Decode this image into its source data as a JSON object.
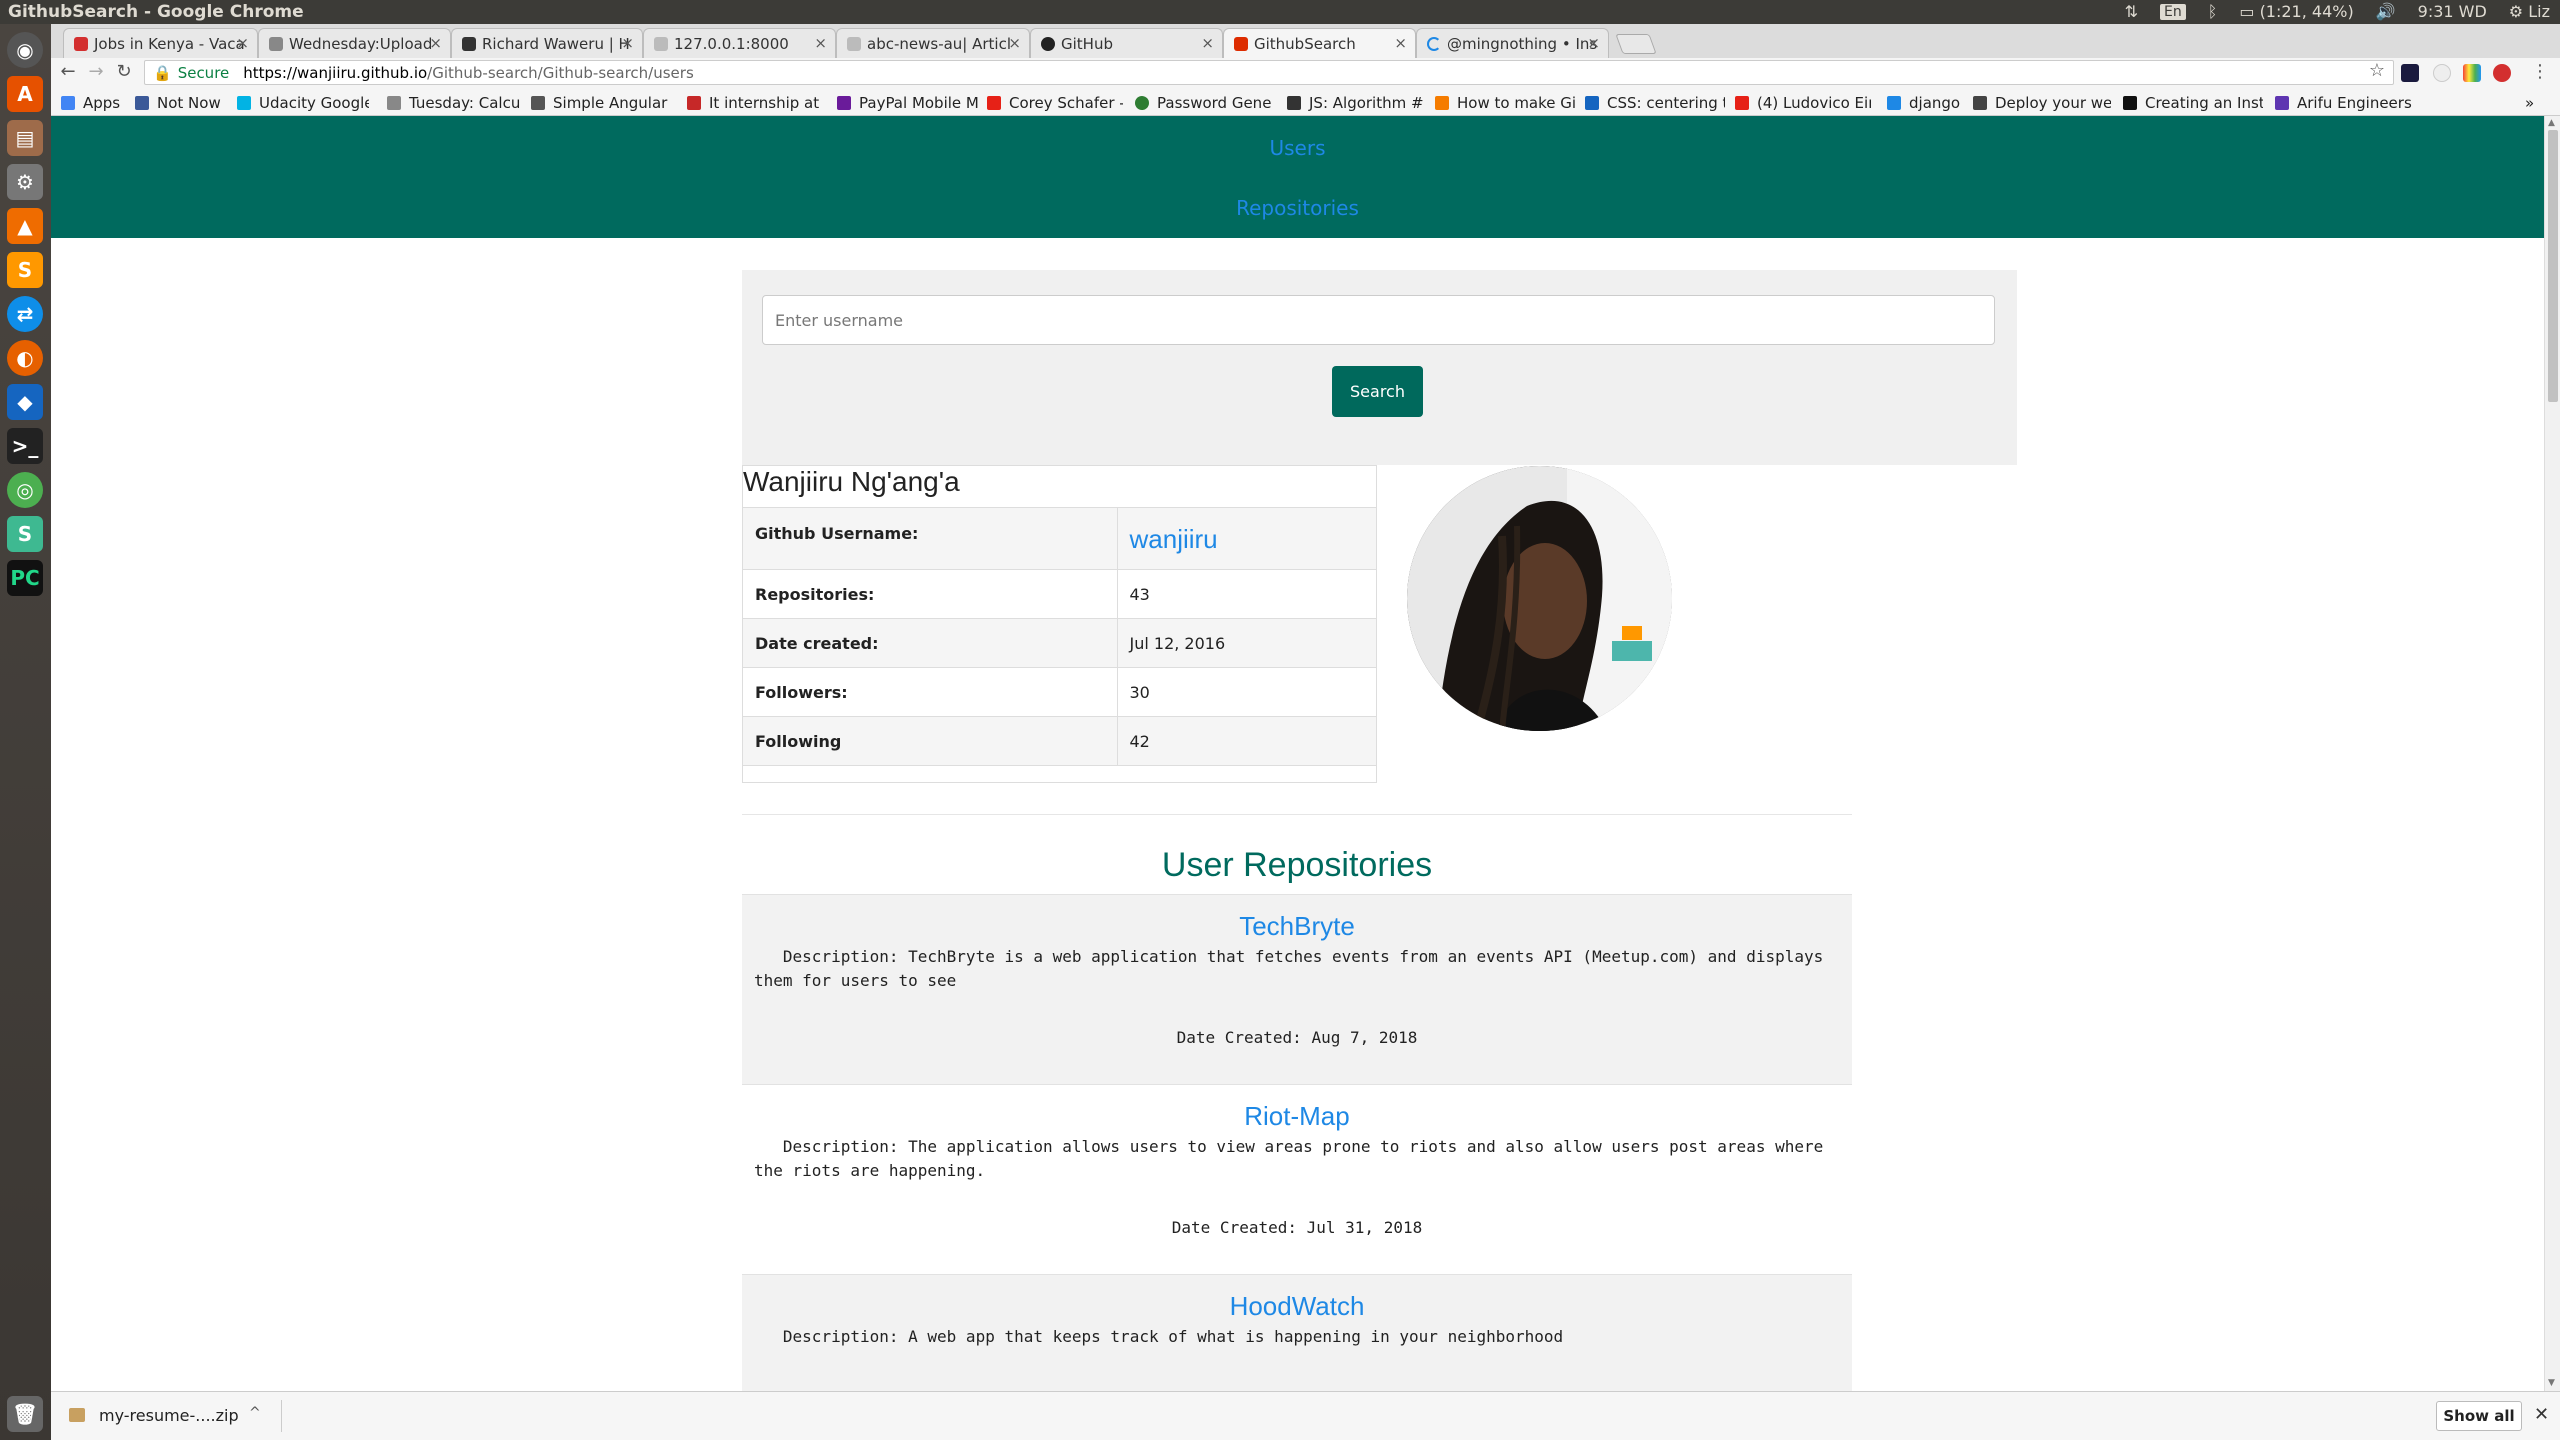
{
  "os": {
    "window_title": "GithubSearch - Google Chrome",
    "lang": "En",
    "battery": "(1:21, 44%)",
    "clock": "9:31 WD",
    "user": "Liz"
  },
  "tabs": [
    {
      "label": "Jobs in Kenya - Vaca",
      "color": "#d32f2f"
    },
    {
      "label": "Wednesday:Upload",
      "color": "#888888"
    },
    {
      "label": "Richard Waweru | H",
      "color": "#333333"
    },
    {
      "label": "127.0.0.1:8000",
      "color": "#999999"
    },
    {
      "label": "abc-news-au| Articl",
      "color": "#999999"
    },
    {
      "label": "GitHub",
      "color": "#222222"
    },
    {
      "label": "GithubSearch",
      "color": "#dd2c00"
    },
    {
      "label": "@mingnothing • Ins",
      "color": "#1e88e5"
    }
  ],
  "toolbar": {
    "secure_label": "Secure",
    "url_host": "https://wanjiiru.github.io",
    "url_path": "/Github-search/Github-search/users"
  },
  "bookmarks": [
    {
      "label": "Apps",
      "color": "#4285f4"
    },
    {
      "label": "Not Now",
      "color": "#3b5998"
    },
    {
      "label": "Udacity Google",
      "color": "#02b3e4"
    },
    {
      "label": "Tuesday: Calcula",
      "color": "#888888"
    },
    {
      "label": "Simple Angular",
      "color": "#555555"
    },
    {
      "label": "It internship at",
      "color": "#c62828"
    },
    {
      "label": "PayPal Mobile M",
      "color": "#6a1b9a"
    },
    {
      "label": "Corey Schafer -",
      "color": "#e62117"
    },
    {
      "label": "Password Gene",
      "color": "#2e7d32"
    },
    {
      "label": "JS: Algorithm #",
      "color": "#333333"
    },
    {
      "label": "How to make Gi",
      "color": "#f57c00"
    },
    {
      "label": "CSS: centering t",
      "color": "#1565c0"
    },
    {
      "label": "(4) Ludovico Ein",
      "color": "#e62117"
    },
    {
      "label": "django",
      "color": "#1e88e5"
    },
    {
      "label": "Deploy your we",
      "color": "#444444"
    },
    {
      "label": "Creating an Inst",
      "color": "#111111"
    },
    {
      "label": "Arifu Engineers",
      "color": "#5e35b1"
    }
  ],
  "nav": {
    "users_label": "Users",
    "repos_label": "Repositories"
  },
  "search": {
    "placeholder": "Enter username",
    "button_label": "Search"
  },
  "profile": {
    "name": "Wanjiiru Ng'ang'a",
    "rows": [
      {
        "label": "Github Username:",
        "value": "wanjiiru"
      },
      {
        "label": "Repositories:",
        "value": "43"
      },
      {
        "label": "Date created:",
        "value": "Jul 12, 2016"
      },
      {
        "label": "Followers:",
        "value": "30"
      },
      {
        "label": "Following",
        "value": "42"
      }
    ]
  },
  "repos": {
    "heading": "User Repositories",
    "items": [
      {
        "name": "TechBryte",
        "description": "   Description: TechBryte is a web application that fetches events from an events API (Meetup.com) and displays them for users to see",
        "date": "Date Created: Aug 7, 2018"
      },
      {
        "name": "Riot-Map",
        "description": "   Description: The application allows users to view areas prone to riots and also allow users post areas where the riots are happening.",
        "date": "Date Created: Jul 31, 2018"
      },
      {
        "name": "HoodWatch",
        "description": "   Description: A web app that keeps track of what is happening in your neighborhood",
        "date": ""
      }
    ]
  },
  "downloads": {
    "file": "my-resume-....zip",
    "show_all": "Show all"
  },
  "colors": {
    "navbar": "#006a5e",
    "link": "#1e88e5",
    "button": "#00695c",
    "heading": "#006a5e"
  }
}
